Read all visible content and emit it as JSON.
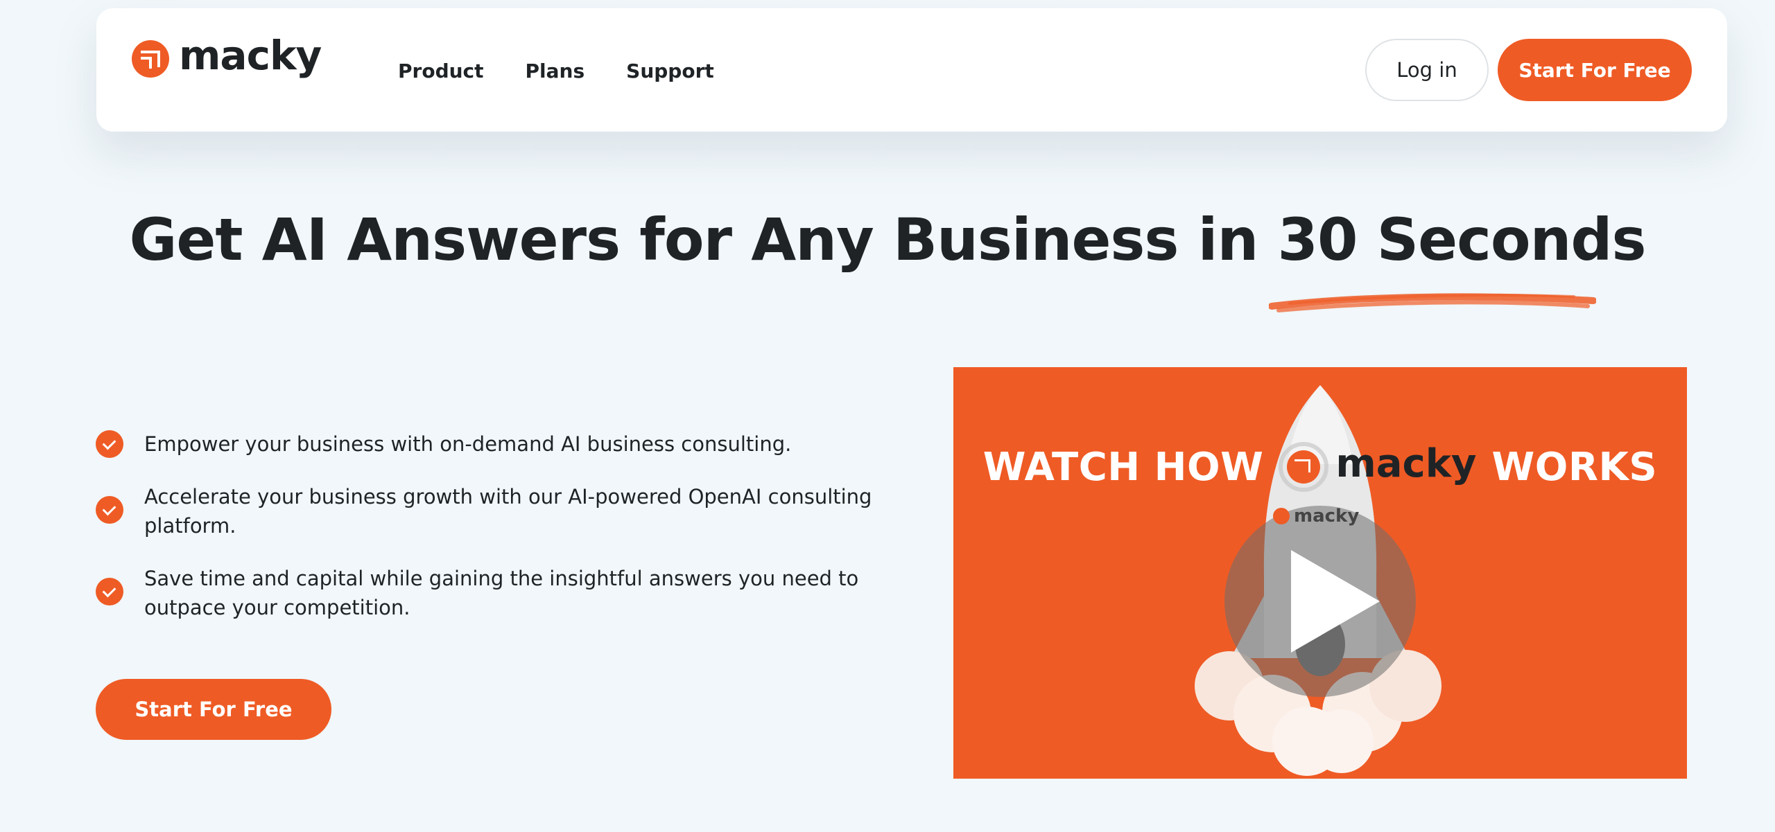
{
  "header": {
    "brand": "macky",
    "nav": [
      {
        "label": "Product"
      },
      {
        "label": "Plans"
      },
      {
        "label": "Support"
      }
    ],
    "login_label": "Log in",
    "cta_label": "Start For Free"
  },
  "hero": {
    "title": "Get AI Answers for Any Business in 30 Seconds",
    "features": [
      "Empower your business with on-demand AI business consulting.",
      "Accelerate your business growth with our AI-powered OpenAI consulting platform.",
      "Save time and capital while gaining the insightful answers you need to outpace your competition."
    ],
    "cta_label": "Start For Free"
  },
  "video": {
    "title_left": "WATCH HOW",
    "title_brand": "macky",
    "title_right": "WORKS",
    "rocket_label": "macky"
  },
  "colors": {
    "accent": "#ef5b25",
    "background": "#f1f7fa",
    "text": "#1f2326"
  }
}
